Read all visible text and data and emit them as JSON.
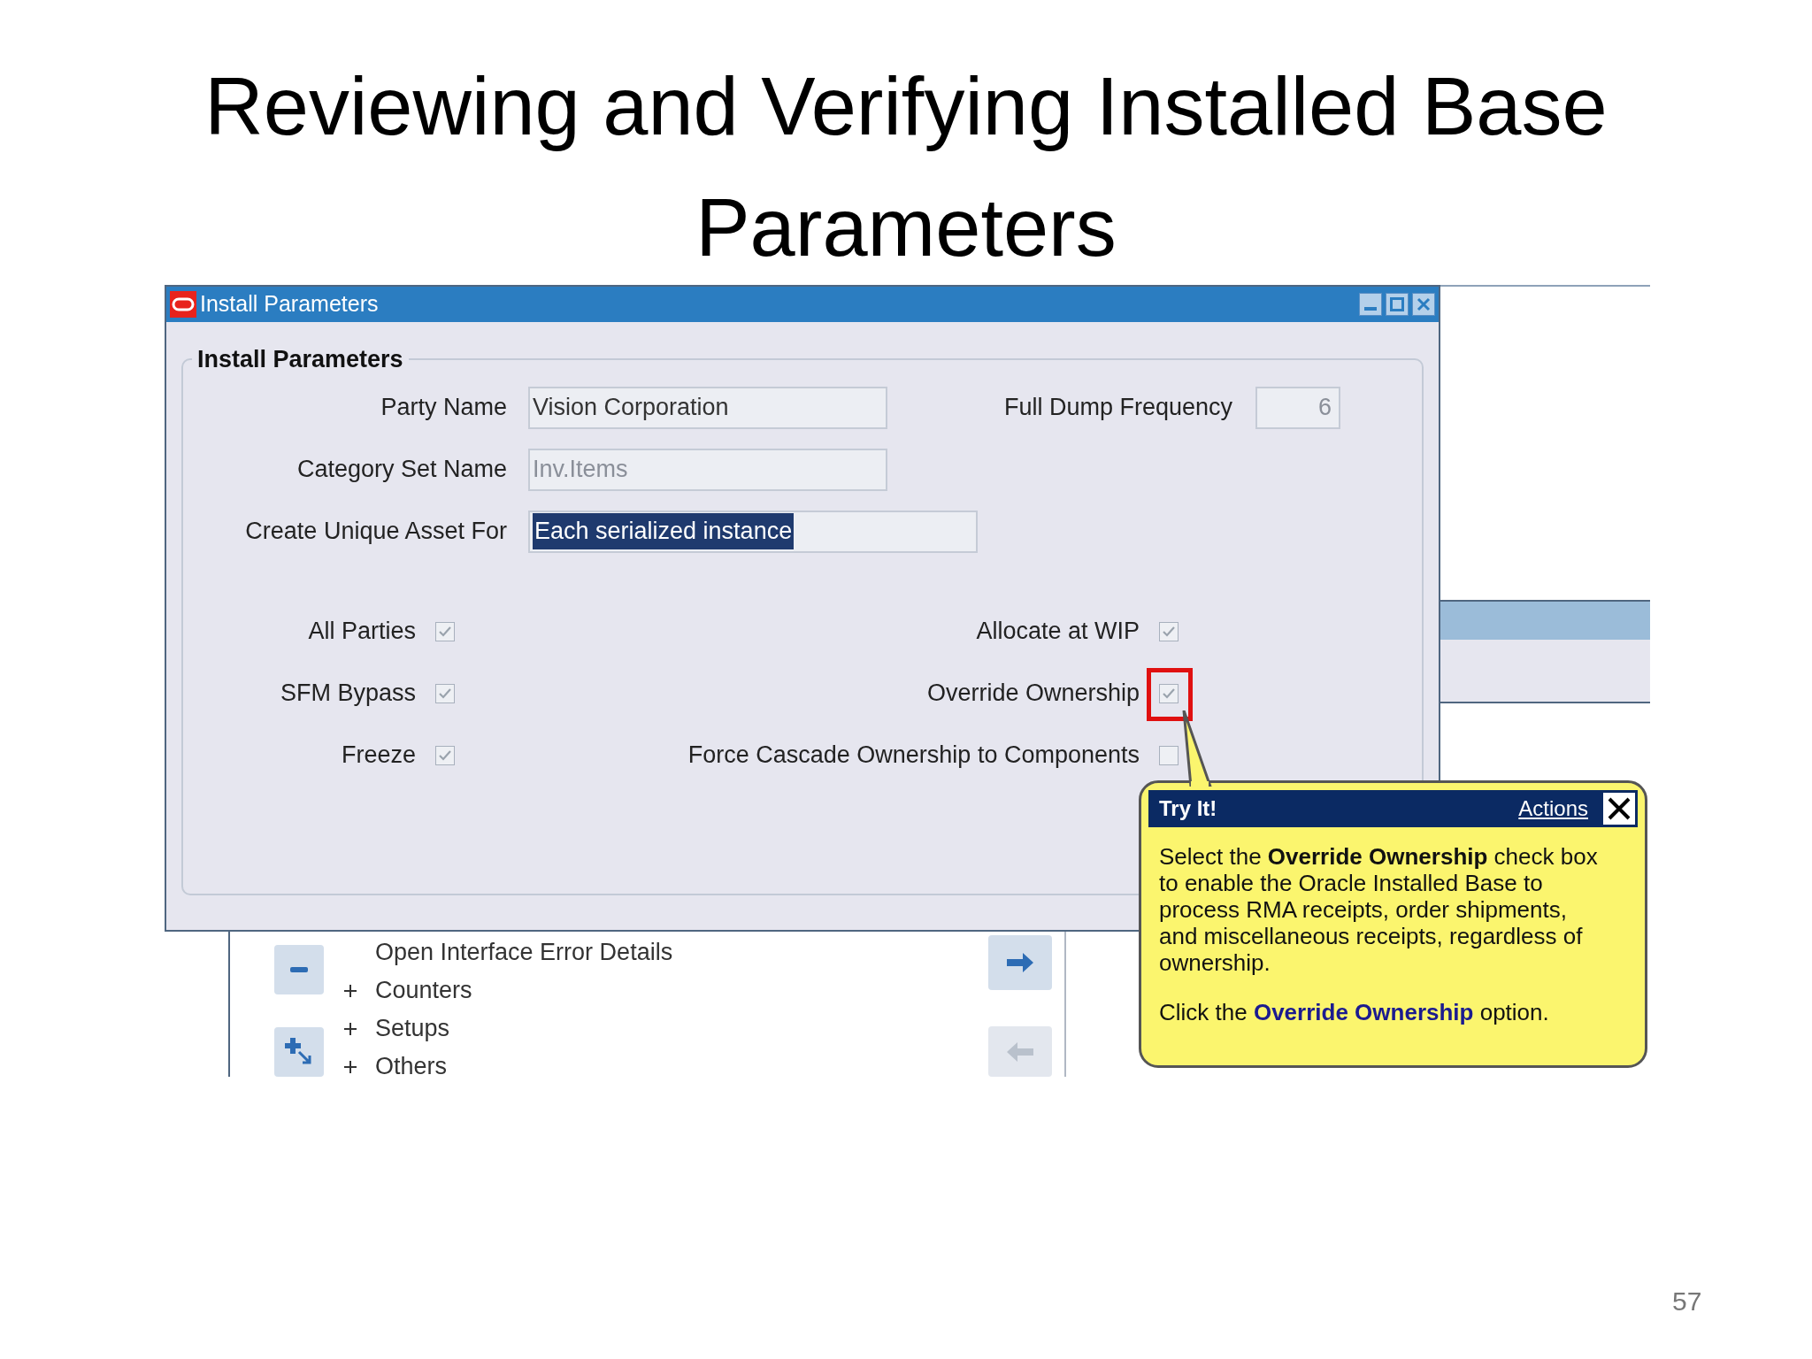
{
  "slide_title": "Reviewing and Verifying Installed Base Parameters",
  "window": {
    "title": "Install Parameters",
    "group_title": "Install Parameters",
    "fields": [
      {
        "label": "Party Name",
        "value": "Vision Corporation",
        "disabled": false,
        "selected": false
      },
      {
        "label": "Category Set Name",
        "value": "Inv.Items",
        "disabled": true,
        "selected": false
      },
      {
        "label": "Create Unique Asset For",
        "value": "Each serialized instance",
        "disabled": false,
        "selected": true
      }
    ],
    "side_field": {
      "label": "Full Dump Frequency",
      "value": "6"
    },
    "left_checkboxes": [
      {
        "label": "All Parties",
        "checked": true
      },
      {
        "label": "SFM Bypass",
        "checked": true
      },
      {
        "label": "Freeze",
        "checked": true
      }
    ],
    "right_checkboxes": [
      {
        "label": "Allocate at WIP",
        "checked": true,
        "highlighted": false
      },
      {
        "label": "Override Ownership",
        "checked": true,
        "highlighted": true
      },
      {
        "label": "Force Cascade Ownership to Components",
        "checked": false,
        "highlighted": false
      }
    ]
  },
  "background_tree": [
    {
      "label": "Open Interface Error Details",
      "collapsed": false
    },
    {
      "label": "Counters",
      "collapsed": true
    },
    {
      "label": "Setups",
      "collapsed": true
    },
    {
      "label": "Others",
      "collapsed": true
    }
  ],
  "tooltip": {
    "title": "Try It!",
    "link": "Actions",
    "body": "Select the **Override Ownership** check box to enable the Oracle Installed Base to process RMA receipts, order shipments, and miscellaneous receipts, regardless of ownership.",
    "instruction": "Click the **Override Ownership** option."
  },
  "page_number": "57"
}
